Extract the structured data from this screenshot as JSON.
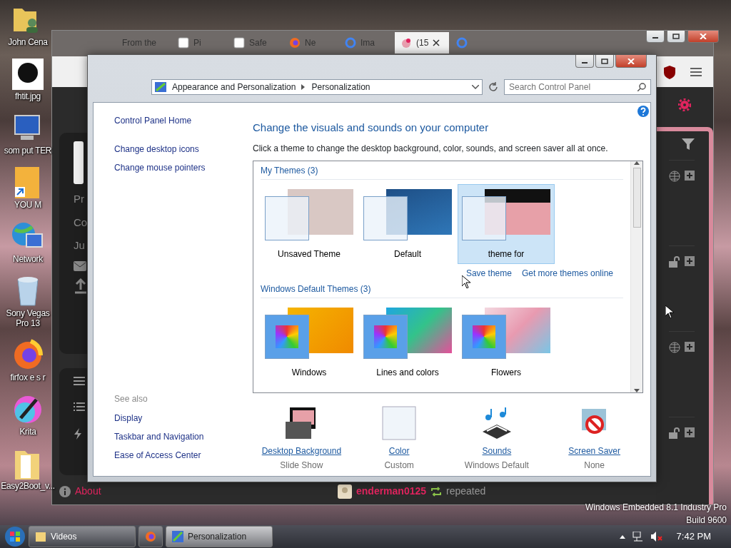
{
  "desktop_icons": [
    {
      "label": "John Cena",
      "kind": "user-folder"
    },
    {
      "label": "fhtit.jpg",
      "kind": "image"
    },
    {
      "label": "som put TER",
      "kind": "computer"
    },
    {
      "label": "YOU M",
      "kind": "shortcut-doc"
    },
    {
      "label": "Network",
      "kind": "network"
    },
    {
      "label": "Sony Vegas Pro 13",
      "kind": "bin"
    },
    {
      "label": "firfox e s r",
      "kind": "browser"
    },
    {
      "label": "Krita",
      "kind": "paint"
    },
    {
      "label": "Easy2Boot_v...",
      "kind": "folder"
    }
  ],
  "browser": {
    "tabs": [
      {
        "label": "From the",
        "kind": "plain",
        "selected": false
      },
      {
        "label": "Pi",
        "kind": "square",
        "selected": false
      },
      {
        "label": "Safe",
        "kind": "square",
        "selected": false
      },
      {
        "label": "Ne",
        "kind": "fox",
        "selected": false
      },
      {
        "label": "Ima",
        "kind": "g",
        "selected": false
      },
      {
        "label": "(15",
        "kind": "dot",
        "selected": true
      },
      {
        "kind": "g",
        "selected": false
      }
    ],
    "side_labels": [
      "Pr",
      "Co",
      "Ju"
    ],
    "about": "About",
    "post": {
      "user": "enderman0125",
      "action": "repeated"
    }
  },
  "control_panel": {
    "breadcrumbs": [
      "Appearance and Personalization",
      "Personalization"
    ],
    "search": {
      "placeholder": "Search Control Panel"
    },
    "nav": [
      "Control Panel Home",
      "Change desktop icons",
      "Change mouse pointers"
    ],
    "see_also": {
      "heading": "See also",
      "links": [
        "Display",
        "Taskbar and Navigation",
        "Ease of Access Center"
      ]
    },
    "title": "Change the visuals and sounds on your computer",
    "description": "Click a theme to change the desktop background, color, sounds, and screen saver all at once.",
    "theme_groups": [
      {
        "heading": "My Themes (3)",
        "themes": [
          {
            "name": "Unsaved Theme",
            "kind": "photo",
            "selected": false
          },
          {
            "name": "Default",
            "kind": "blue",
            "selected": false
          },
          {
            "name": "theme for",
            "kind": "stack",
            "selected": true
          }
        ],
        "links": [
          "Save theme",
          "Get more themes online"
        ]
      },
      {
        "heading": "Windows Default Themes (3)",
        "themes": [
          {
            "name": "Windows",
            "kind": "windows",
            "selected": false
          },
          {
            "name": "Lines and colors",
            "kind": "lines",
            "selected": false
          },
          {
            "name": "Flowers",
            "kind": "flowers",
            "selected": false
          }
        ]
      }
    ],
    "settings": [
      {
        "label": "Desktop Background",
        "value": "Slide Show",
        "kind": "background"
      },
      {
        "label": "Color",
        "value": "Custom",
        "kind": "color"
      },
      {
        "label": "Sounds",
        "value": "Windows Default",
        "kind": "sounds"
      },
      {
        "label": "Screen Saver",
        "value": "None",
        "kind": "saver"
      }
    ]
  },
  "os_label": [
    "Windows Embedded 8.1 Industry Pro",
    "Build 9600"
  ],
  "taskbar": {
    "buttons": [
      {
        "label": "Videos",
        "kind": "folder",
        "selected": false
      },
      {
        "kind": "fox",
        "selected": false
      },
      {
        "label": "Personalization",
        "kind": "panel",
        "selected": true
      }
    ],
    "clock": "7:42 PM"
  }
}
